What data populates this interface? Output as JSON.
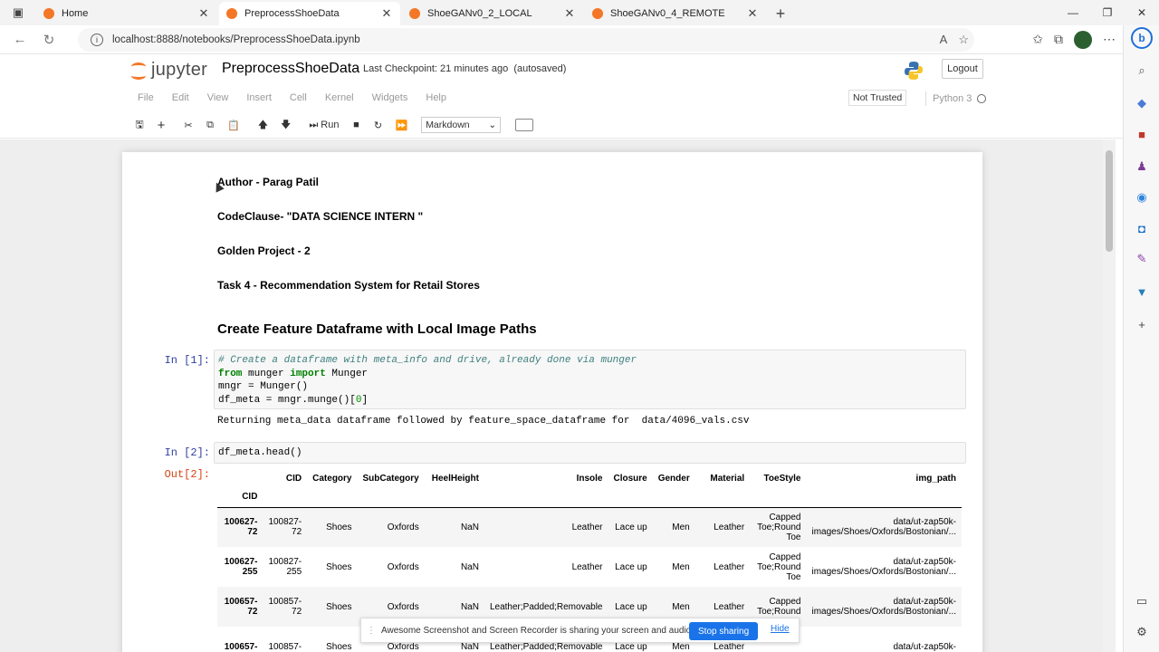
{
  "browser": {
    "tabs": [
      {
        "title": "Home",
        "active": false
      },
      {
        "title": "PreprocessShoeData",
        "active": true
      },
      {
        "title": "ShoeGANv0_2_LOCAL",
        "active": false
      },
      {
        "title": "ShoeGANv0_4_REMOTE",
        "active": false
      }
    ],
    "url": "localhost:8888/notebooks/PreprocessShoeData.ipynb"
  },
  "jupyter": {
    "logo_text": "jupyter",
    "notebook_name": "PreprocessShoeData",
    "checkpoint": "Last Checkpoint: 21 minutes ago",
    "autosave": "(autosaved)",
    "logout": "Logout",
    "menu": [
      "File",
      "Edit",
      "View",
      "Insert",
      "Cell",
      "Kernel",
      "Widgets",
      "Help"
    ],
    "trust": "Not Trusted",
    "kernel": "Python 3",
    "toolbar": {
      "run_label": "Run",
      "cell_type": "Markdown"
    }
  },
  "markdown": {
    "author": "Author - Parag Patil",
    "org": "CodeClause- \"DATA SCIENCE INTERN \"",
    "project": "Golden Project - 2",
    "task": "Task 4 - Recommendation System for Retail Stores",
    "heading": "Create Feature Dataframe with Local Image Paths"
  },
  "cells": {
    "in1_prompt": "In [1]:",
    "in1_comment": "# Create a dataframe with meta_info and drive, already done via munger",
    "in1_line2_kw1": "from",
    "in1_line2_mod": " munger ",
    "in1_line2_kw2": "import",
    "in1_line2_name": " Munger",
    "in1_line3": "mngr = Munger()",
    "in1_line4a": "df_meta = mngr.munge()[",
    "in1_line4_num": "0",
    "in1_line4b": "]",
    "out1_stdout": "Returning meta_data dataframe followed by feature_space_dataframe for  data/4096_vals.csv",
    "in2_prompt": "In [2]:",
    "in2_code": "df_meta.head()",
    "out2_prompt": "Out[2]:"
  },
  "dataframe": {
    "columns": [
      "",
      "CID",
      "Category",
      "SubCategory",
      "HeelHeight",
      "Insole",
      "Closure",
      "Gender",
      "Material",
      "ToeStyle",
      "img_path"
    ],
    "index_name": "CID",
    "rows": [
      {
        "idx": [
          "100627-",
          "72"
        ],
        "cid": [
          "100827-",
          "72"
        ],
        "category": "Shoes",
        "subcategory": "Oxfords",
        "heel": "NaN",
        "insole": "Leather",
        "closure": "Lace up",
        "gender": "Men",
        "material": "Leather",
        "toe": [
          "Capped",
          "Toe;Round",
          "Toe"
        ],
        "img": [
          "data/ut-zap50k-",
          "images/Shoes/Oxfords/Bostonian/..."
        ]
      },
      {
        "idx": [
          "100627-",
          "255"
        ],
        "cid": [
          "100827-",
          "255"
        ],
        "category": "Shoes",
        "subcategory": "Oxfords",
        "heel": "NaN",
        "insole": "Leather",
        "closure": "Lace up",
        "gender": "Men",
        "material": "Leather",
        "toe": [
          "Capped",
          "Toe;Round",
          "Toe"
        ],
        "img": [
          "data/ut-zap50k-",
          "images/Shoes/Oxfords/Bostonian/..."
        ]
      },
      {
        "idx": [
          "100657-",
          "72"
        ],
        "cid": [
          "100857-",
          "72"
        ],
        "category": "Shoes",
        "subcategory": "Oxfords",
        "heel": "NaN",
        "insole": "Leather;Padded;Removable",
        "closure": "Lace up",
        "gender": "Men",
        "material": "Leather",
        "toe": [
          "Capped",
          "Toe;Round",
          ""
        ],
        "img": [
          "data/ut-zap50k-",
          "images/Shoes/Oxfords/Bostonian/..."
        ]
      },
      {
        "idx": [
          "100657-",
          ""
        ],
        "cid": [
          "100857-",
          ""
        ],
        "category": "Shoes",
        "subcategory": "Oxfords",
        "heel": "NaN",
        "insole": "Leather;Padded;Removable",
        "closure": "Lace up",
        "gender": "Men",
        "material": "Leather",
        "toe": [
          "",
          "",
          ""
        ],
        "img": [
          "data/ut-zap50k-",
          ""
        ]
      }
    ]
  },
  "sharebar": {
    "message": "Awesome Screenshot and Screen Recorder is sharing your screen and audio.",
    "stop": "Stop sharing",
    "hide": "Hide"
  },
  "colors": {
    "jupyter_orange": "#f37726",
    "prompt_in": "#303f9f",
    "prompt_out": "#d84315",
    "share_blue": "#1a73e8"
  }
}
